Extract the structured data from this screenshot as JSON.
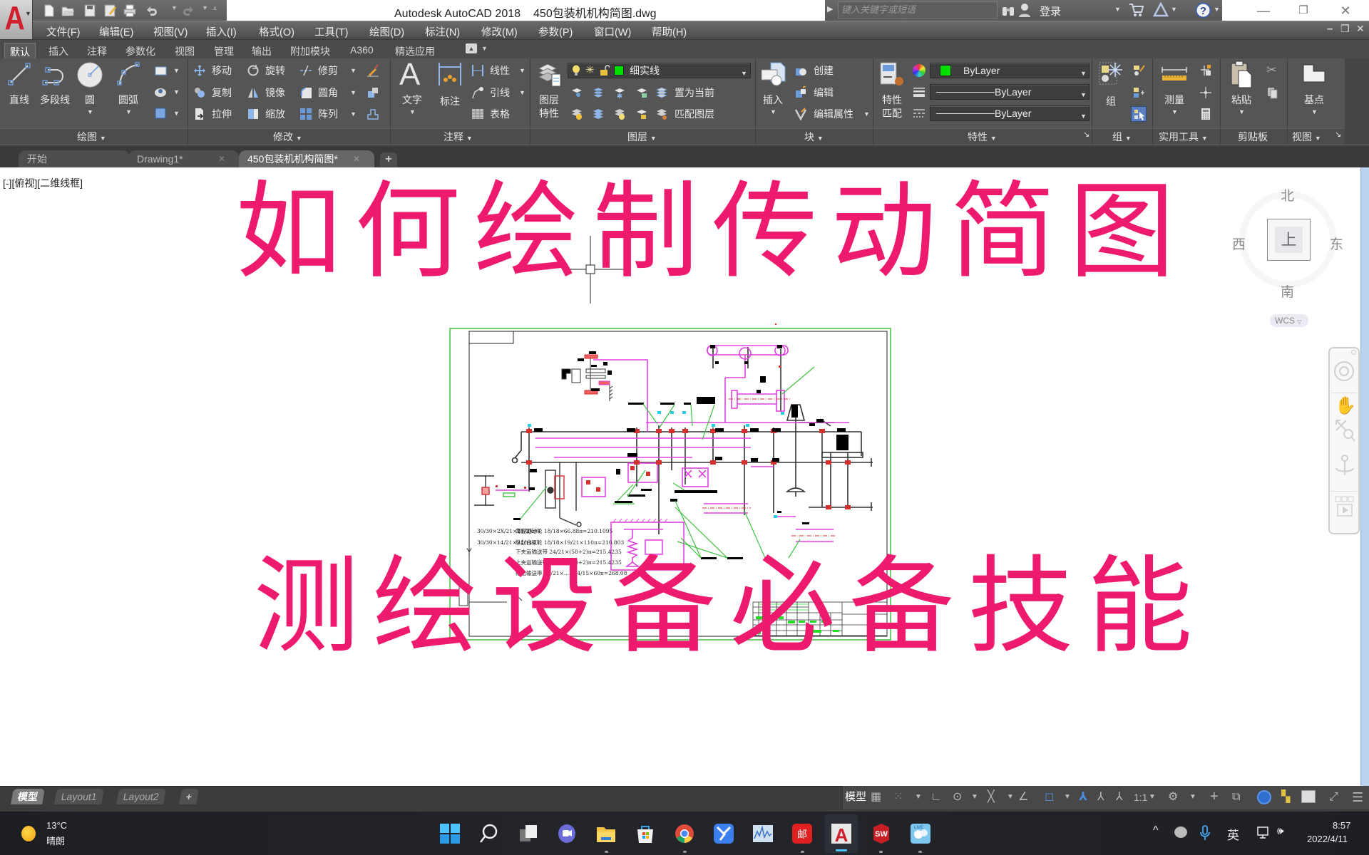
{
  "app": {
    "name": "Autodesk AutoCAD 2018",
    "file": "450包装机机构简图.dwg"
  },
  "search": {
    "placeholder": "键入关键字或短语"
  },
  "user": {
    "login": "登录"
  },
  "menu": [
    "文件(F)",
    "编辑(E)",
    "视图(V)",
    "插入(I)",
    "格式(O)",
    "工具(T)",
    "绘图(D)",
    "标注(N)",
    "修改(M)",
    "参数(P)",
    "窗口(W)",
    "帮助(H)"
  ],
  "ribbon_tabs": [
    {
      "label": "默认",
      "active": true
    },
    {
      "label": "插入"
    },
    {
      "label": "注释"
    },
    {
      "label": "参数化"
    },
    {
      "label": "视图"
    },
    {
      "label": "管理"
    },
    {
      "label": "输出"
    },
    {
      "label": "附加模块"
    },
    {
      "label": "A360"
    },
    {
      "label": "精选应用"
    }
  ],
  "panels": {
    "draw": {
      "title": "绘图",
      "line": "直线",
      "polyline": "多段线",
      "circle": "圆",
      "arc": "圆弧"
    },
    "modify": {
      "title": "修改",
      "move": "移动",
      "rotate": "旋转",
      "trim": "修剪",
      "copy": "复制",
      "mirror": "镜像",
      "fillet": "圆角",
      "stretch": "拉伸",
      "scale": "缩放",
      "array": "阵列"
    },
    "annotation": {
      "title": "注释",
      "text": "文字",
      "dimension": "标注",
      "linear": "线性",
      "leader": "引线",
      "table": "表格"
    },
    "layers": {
      "title": "图层",
      "properties_1": "图层",
      "properties_2": "特性",
      "current_layer": "细实线",
      "make_current": "置为当前",
      "match_layer": "匹配图层"
    },
    "block": {
      "title": "块",
      "insert": "插入",
      "create": "创建",
      "edit": "编辑",
      "edit_attributes": "编辑属性"
    },
    "properties": {
      "title": "特性",
      "match_1": "特性",
      "match_2": "匹配",
      "color": "ByLayer",
      "lineweight": "ByLayer",
      "linetype": "ByLayer"
    },
    "groups": {
      "title": "组",
      "group": "组"
    },
    "utilities": {
      "title": "实用工具",
      "measure": "测量"
    },
    "clipboard": {
      "title": "剪贴板",
      "paste": "粘贴"
    },
    "view": {
      "title": "视图",
      "base": "基点"
    }
  },
  "file_tabs": [
    {
      "label": "开始"
    },
    {
      "label": "Drawing1*"
    },
    {
      "label": "450包装机机构简图*",
      "active": true
    }
  ],
  "viewport": {
    "label": "[-][俯视][二维线框]"
  },
  "viewcube": {
    "north": "北",
    "south": "南",
    "east": "东",
    "west": "西",
    "face": "上",
    "ucs": "WCS"
  },
  "overlay": {
    "title": [
      "如",
      "何",
      "绘",
      "制",
      "传",
      "动",
      "简",
      "图"
    ],
    "subtitle": [
      "测",
      "绘",
      "设",
      "备",
      "必",
      "备",
      "技",
      "能"
    ]
  },
  "drawing": {
    "ucs_label": "Y",
    "formulas_left": [
      "30/30×2X/21×21/2X=1",
      "30/30×14/21×21/14=1"
    ],
    "formulas_right": [
      "薄膜驱动轮  18/18×66.88π=210.1095",
      "纵封合驱轮  18/18×19/21×110π=210.803",
      "下夹运输送带 24/21×(58+2)π=215.4235",
      "上夹运输送带 24/21×(58+2)π=215.4235",
      "输出输送带 24/21×…×14/15×60π=268.08"
    ]
  },
  "layout_tabs": [
    {
      "label": "模型",
      "active": true
    },
    {
      "label": "Layout1"
    },
    {
      "label": "Layout2"
    }
  ],
  "status": {
    "model": "模型",
    "scale": "1:1"
  },
  "taskbar": {
    "temperature": "13°C",
    "weather": "晴朗",
    "ime": "英",
    "time": "8:57",
    "date": "2022/4/11"
  },
  "colors": {
    "overlay_pink": "#ee1a6e",
    "layer_color": "#00e000",
    "frame_green": "#3ec13e",
    "magenta": "#e040e0",
    "autocad_red": "#d0202e"
  }
}
